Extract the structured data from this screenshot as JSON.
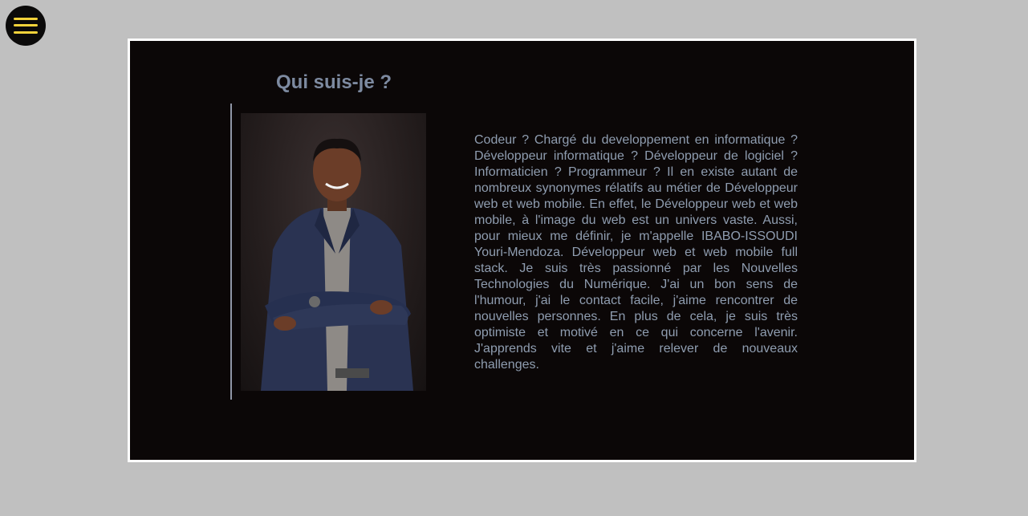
{
  "menu": {
    "icon": "hamburger-menu-icon",
    "accent_color": "#f2d23a"
  },
  "about": {
    "title": "Qui suis-je ?",
    "photo": "portrait-photo",
    "description": "Codeur ? Chargé du developpement en informatique ? Développeur informatique ? Développeur de logiciel ? Informaticien ? Programmeur ? Il en existe autant de nombreux synonymes rélatifs au métier de Développeur web et web mobile. En effet, le Développeur web et web mobile, à l'image du web est un univers vaste. Aussi, pour mieux me définir, je m'appelle IBABO-ISSOUDI Youri-Mendoza. Développeur web et web mobile full stack. Je suis très passionné par les Nouvelles Technologies du Numérique. J'ai un bon sens de l'humour, j'ai le contact facile, j'aime rencontrer de nouvelles personnes. En plus de cela, je suis très optimiste et motivé en ce qui concerne l'avenir. J'apprends vite et j'aime relever de nouveaux challenges."
  },
  "colors": {
    "page_background": "#c0c0c0",
    "card_background": "#0b0707",
    "card_border": "#ffffff",
    "text": "#8f9db0",
    "title": "#7d8aa0"
  }
}
